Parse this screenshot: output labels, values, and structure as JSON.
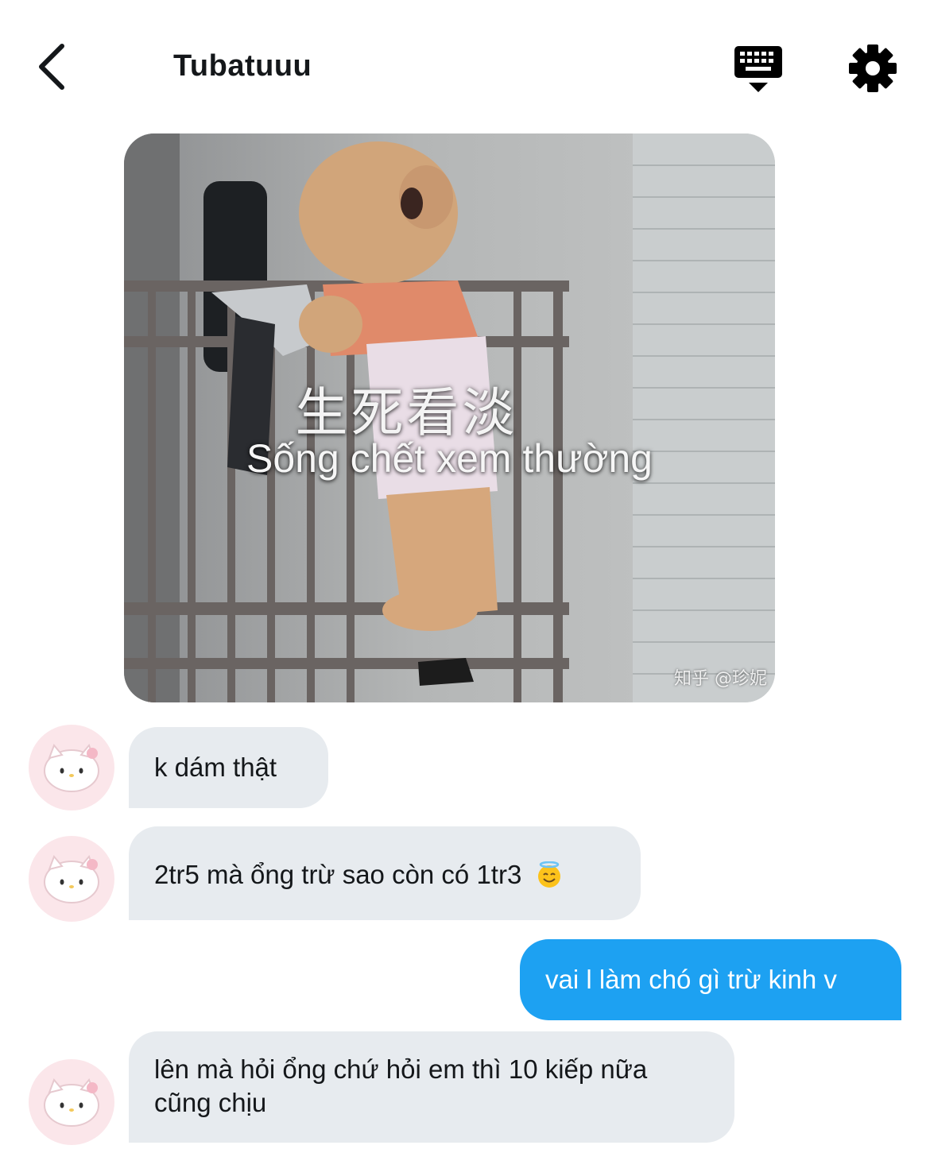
{
  "header": {
    "title": "Tubatuuu"
  },
  "media": {
    "caption_chinese": "生死看淡",
    "caption_vietnamese": "Sống chết xem thường",
    "watermark": "知乎 @珍妮"
  },
  "messages": [
    {
      "direction": "incoming",
      "text": "k dám thật"
    },
    {
      "direction": "incoming",
      "text": "2tr5 mà ổng trừ sao còn có 1tr3",
      "emoji": "smiling-face-with-halo"
    },
    {
      "direction": "outgoing",
      "text": "vai l làm chó gì trừ kinh v"
    },
    {
      "direction": "incoming",
      "lines": [
        "lên mà hỏi ổng chứ hỏi em thì 10 kiếp nữa",
        "cũng chịu"
      ]
    }
  ],
  "colors": {
    "incoming_bubble": "#e7ebef",
    "outgoing_bubble": "#1da1f2",
    "avatar_background": "#fbe6ea"
  },
  "icons": [
    "back-arrow-icon",
    "keyboard-icon",
    "gear-icon",
    "avatar-icon",
    "emoji-halo-icon"
  ]
}
